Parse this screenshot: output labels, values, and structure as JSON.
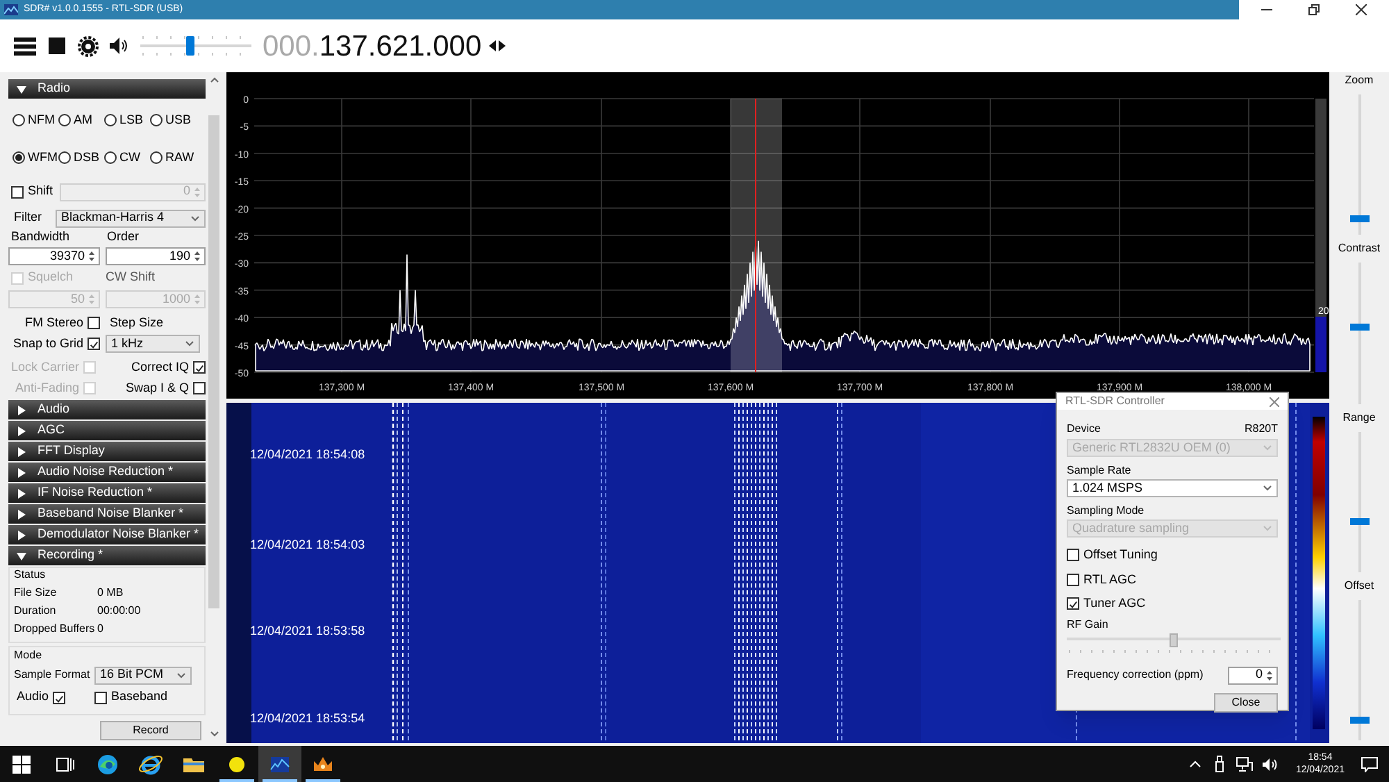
{
  "window": {
    "title": "SDR# v1.0.0.1555 - RTL-SDR (USB)"
  },
  "toolbar": {
    "volume": {
      "level": 0.45
    },
    "frequency_prefix": "000.",
    "frequency": "137.621.000"
  },
  "radio_panel": {
    "title": "Radio",
    "expanded": true,
    "modes": [
      {
        "label": "NFM",
        "selected": false
      },
      {
        "label": "AM",
        "selected": false
      },
      {
        "label": "LSB",
        "selected": false
      },
      {
        "label": "USB",
        "selected": false
      },
      {
        "label": "WFM",
        "selected": true
      },
      {
        "label": "DSB",
        "selected": false
      },
      {
        "label": "CW",
        "selected": false
      },
      {
        "label": "RAW",
        "selected": false
      }
    ],
    "shift": {
      "label": "Shift",
      "checked": false,
      "value": "0"
    },
    "filter": {
      "label": "Filter",
      "value": "Blackman-Harris 4"
    },
    "bandwidth": {
      "label": "Bandwidth",
      "value": "39370"
    },
    "order": {
      "label": "Order",
      "value": "190"
    },
    "squelch": {
      "label": "Squelch",
      "checked": false,
      "disabled": true,
      "value": "50"
    },
    "cw_shift": {
      "label": "CW Shift",
      "value": "1000",
      "disabled": true
    },
    "fm_stereo": {
      "label": "FM Stereo",
      "checked": false,
      "disabled": false
    },
    "step_size": {
      "label": "Step Size",
      "value": "1 kHz"
    },
    "snap_to_grid": {
      "label": "Snap to Grid",
      "checked": true,
      "disabled": false
    },
    "lock_carrier": {
      "label": "Lock Carrier",
      "checked": false,
      "disabled": true
    },
    "correct_iq": {
      "label": "Correct IQ",
      "checked": true,
      "disabled": false
    },
    "anti_fading": {
      "label": "Anti-Fading",
      "checked": false,
      "disabled": true
    },
    "swap_iq": {
      "label": "Swap I & Q",
      "checked": false,
      "disabled": false
    }
  },
  "sections": [
    {
      "title": "Audio",
      "expanded": false
    },
    {
      "title": "AGC",
      "expanded": false
    },
    {
      "title": "FFT Display",
      "expanded": false
    },
    {
      "title": "Audio Noise Reduction *",
      "expanded": false
    },
    {
      "title": "IF Noise Reduction *",
      "expanded": false
    },
    {
      "title": "Baseband Noise Blanker *",
      "expanded": false
    },
    {
      "title": "Demodulator Noise Blanker *",
      "expanded": false
    },
    {
      "title": "Recording *",
      "expanded": true
    }
  ],
  "recording": {
    "status_title": "Status",
    "status": [
      {
        "label": "File Size",
        "value": "0 MB"
      },
      {
        "label": "Duration",
        "value": "00:00:00"
      },
      {
        "label": "Dropped Buffers",
        "value": "0"
      }
    ],
    "mode_title": "Mode",
    "sample_format": {
      "label": "Sample Format",
      "value": "16 Bit PCM"
    },
    "audio": {
      "label": "Audio",
      "checked": true
    },
    "baseband": {
      "label": "Baseband",
      "checked": false
    },
    "record_button": "Record"
  },
  "spectrum": {
    "y_labels": [
      "0",
      "-5",
      "-10",
      "-15",
      "-20",
      "-25",
      "-30",
      "-35",
      "-40",
      "-45",
      "-50"
    ],
    "x_labels": [
      "137,300 M",
      "137,400 M",
      "137,500 M",
      "137,600 M",
      "137,700 M",
      "137,800 M",
      "137,900 M",
      "138,000 M"
    ],
    "meter_label": "20"
  },
  "waterfall": {
    "timestamps": [
      "12/04/2021 18:54:08",
      "12/04/2021 18:54:03",
      "12/04/2021 18:53:58",
      "12/04/2021 18:53:54"
    ]
  },
  "side_sliders": [
    {
      "label": "Zoom",
      "level": 0.1
    },
    {
      "label": "Contrast",
      "level": 0.55
    },
    {
      "label": "Range",
      "level": 0.35
    },
    {
      "label": "Offset",
      "level": 0.12
    }
  ],
  "dialog": {
    "title": "RTL-SDR Controller",
    "device_label": "Device",
    "tuner": "R820T",
    "device": "Generic RTL2832U OEM (0)",
    "sample_rate_label": "Sample Rate",
    "sample_rate": "1.024 MSPS",
    "sampling_mode_label": "Sampling Mode",
    "sampling_mode": "Quadrature sampling",
    "options": [
      {
        "label": "Offset Tuning",
        "checked": false
      },
      {
        "label": "RTL AGC",
        "checked": false
      },
      {
        "label": "Tuner AGC",
        "checked": true
      }
    ],
    "rf_gain": {
      "label": "RF Gain",
      "level": 0.5
    },
    "freq_correction": {
      "label": "Frequency correction (ppm)",
      "value": "0"
    },
    "close_button": "Close"
  },
  "taskbar": {
    "apps": [
      {
        "kind": "start",
        "running": false,
        "selected": false
      },
      {
        "kind": "task_view",
        "running": false,
        "selected": false
      },
      {
        "kind": "edge",
        "running": false,
        "selected": false
      },
      {
        "kind": "ie",
        "running": false,
        "selected": false
      },
      {
        "kind": "explorer",
        "running": false,
        "selected": false
      },
      {
        "kind": "ball",
        "running": true,
        "selected": false
      },
      {
        "kind": "sdr",
        "running": true,
        "selected": true
      },
      {
        "kind": "crown",
        "running": true,
        "selected": false
      }
    ],
    "time": "18:54",
    "date": "12/04/2021"
  }
}
